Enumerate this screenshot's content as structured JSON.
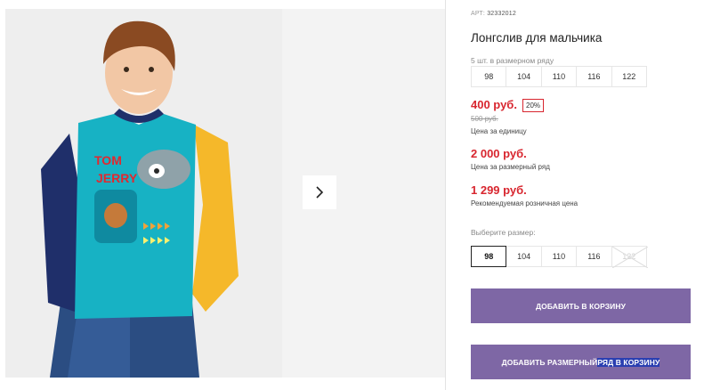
{
  "product": {
    "article_label": "АРТ:",
    "article_number": "32332012",
    "title": "Лонгслив для мальчика"
  },
  "size_range": {
    "label": "5 шт. в размерном ряду",
    "sizes": [
      "98",
      "104",
      "110",
      "116",
      "122"
    ]
  },
  "prices": {
    "unit_price": "400 руб.",
    "discount": "20%",
    "old_price": "500 руб.",
    "unit_caption": "Цена за единицу",
    "range_price": "2 000 руб.",
    "range_caption": "Цена за размерный ряд",
    "retail_price": "1 299 руб.",
    "retail_caption": "Рекомендуемая розничная цена"
  },
  "size_picker": {
    "label": "Выберите размер:",
    "sizes": [
      "98",
      "104",
      "110",
      "116",
      "122"
    ],
    "selected": "98",
    "unavailable": "122"
  },
  "buttons": {
    "add_to_cart": "ДОБАВИТЬ В КОРЗИНУ",
    "add_range_part1": "ДОБАВИТЬ РАЗМЕРНЫЙ ",
    "add_range_part2": "РЯД В КОРЗИНУ"
  },
  "colors": {
    "accent_button": "#7e67a5",
    "price_red": "#d8262f",
    "text_highlight": "#2a3fb1"
  },
  "icons": {
    "next": "chevron-right-icon"
  }
}
